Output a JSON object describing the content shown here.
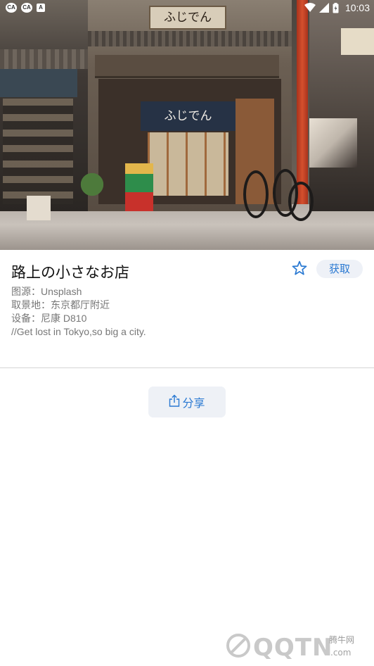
{
  "status_bar": {
    "time": "10:03",
    "notification_icons": [
      "CA",
      "CA",
      "A"
    ],
    "battery_level": "charging"
  },
  "hero": {
    "top_sign": "ふじでん",
    "noren_text": "ふじでん"
  },
  "detail": {
    "title": "路上の小さなお店",
    "get_label": "获取",
    "source": "图源：Unsplash",
    "location": "取景地：东京都厅附近",
    "device": "设备：尼康 D810",
    "caption": "//Get lost in Tokyo,so big a city."
  },
  "actions": {
    "share_label": "分享"
  },
  "watermark": {
    "main": "QQTN",
    "cn": "腾牛网",
    "com": ".com"
  },
  "colors": {
    "accent": "#2a79d2",
    "button_bg": "#eef1f7",
    "text_primary": "#111111",
    "text_secondary": "#777777"
  }
}
